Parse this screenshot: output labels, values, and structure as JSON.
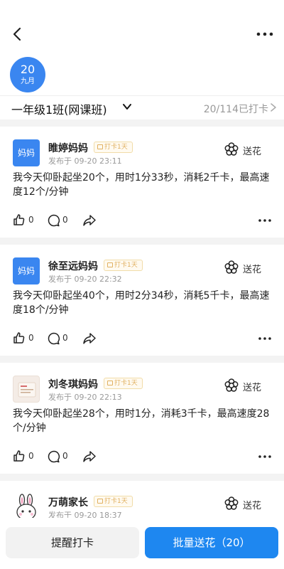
{
  "header": {
    "back_icon": "chevron-left-icon",
    "more_icon": "more-horizontal-icon"
  },
  "date": {
    "day": "20",
    "month": "九月"
  },
  "class_bar": {
    "name": "一年级1班(网课班)",
    "count": "20/114已打卡"
  },
  "posts": [
    {
      "avatar_text": "妈妈",
      "author": "睢婷妈妈",
      "tag": "打卡1天",
      "time": "发布于 09-20 23:11",
      "flower": "送花",
      "content": "我今天仰卧起坐20个，用时1分33秒，消耗2千卡，最高速度12个/分钟",
      "likes": "0",
      "comments": "0"
    },
    {
      "avatar_text": "妈妈",
      "author": "徐至远妈妈",
      "tag": "打卡1天",
      "time": "发布于 09-20 22:32",
      "flower": "送花",
      "content": "我今天仰卧起坐40个，用时2分34秒，消耗5千卡，最高速度18个/分钟",
      "likes": "0",
      "comments": "0"
    },
    {
      "avatar_text": "",
      "author": "刘冬琪妈妈",
      "tag": "打卡1天",
      "time": "发布于 09-20 22:13",
      "flower": "送花",
      "content": "我今天仰卧起坐28个，用时1分，消耗3千卡，最高速度28个/分钟",
      "likes": "0",
      "comments": "0"
    },
    {
      "avatar_text": "",
      "author": "万萌家长",
      "tag": "打卡1天",
      "time": "发布于 09-20 18:37",
      "flower": "送花",
      "content": "",
      "likes": "",
      "comments": ""
    }
  ],
  "bottom": {
    "remind_label": "提醒打卡",
    "batch_label": "批量送花（20）"
  },
  "colors": {
    "accent": "#1e87f0",
    "badge": "#3a86f0",
    "tag": "#e0b060"
  }
}
